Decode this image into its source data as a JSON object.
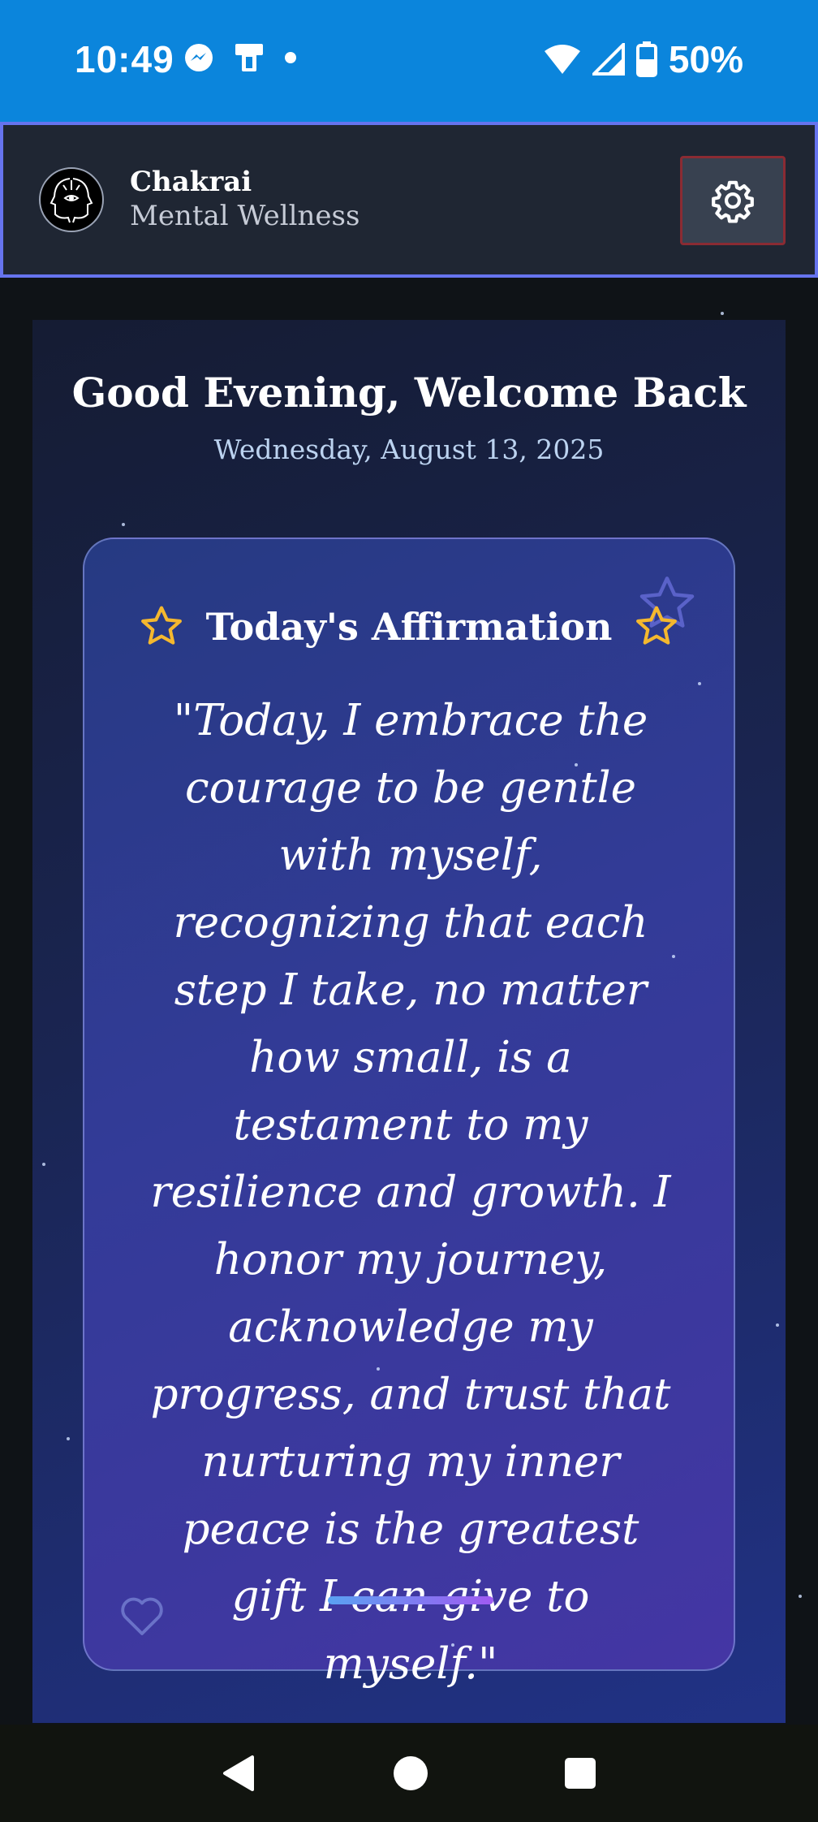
{
  "status_bar": {
    "time": "10:49",
    "battery_text": "50%",
    "icons_left": [
      "messenger-icon",
      "device-icon",
      "notification-dot-icon"
    ],
    "icons_right": [
      "wifi-icon",
      "signal-icon",
      "battery-icon"
    ]
  },
  "header": {
    "app_name": "Chakrai",
    "app_subtitle": "Mental Wellness",
    "logo_icon": "chakrai-logo-icon",
    "settings_icon": "gear-icon"
  },
  "main": {
    "greeting": "Good Evening, Welcome Back",
    "date": "Wednesday, August 13, 2025",
    "affirmation": {
      "title": "Today's Affirmation",
      "text": "\"Today, I embrace the courage to be gentle with myself, recognizing that each step I take, no matter how small, is a testament to my resilience and growth. I honor my journey, acknowledge my progress, and trust that nurturing my inner peace is the greatest gift I can give to myself.\""
    }
  },
  "nav": {
    "back_icon": "back-triangle-icon",
    "home_icon": "home-circle-icon",
    "recents_icon": "recents-square-icon"
  },
  "colors": {
    "status_bar": "#0b85dc",
    "header_bg": "#1f2633",
    "header_border": "#6674ee",
    "star": "#f5b82e"
  }
}
